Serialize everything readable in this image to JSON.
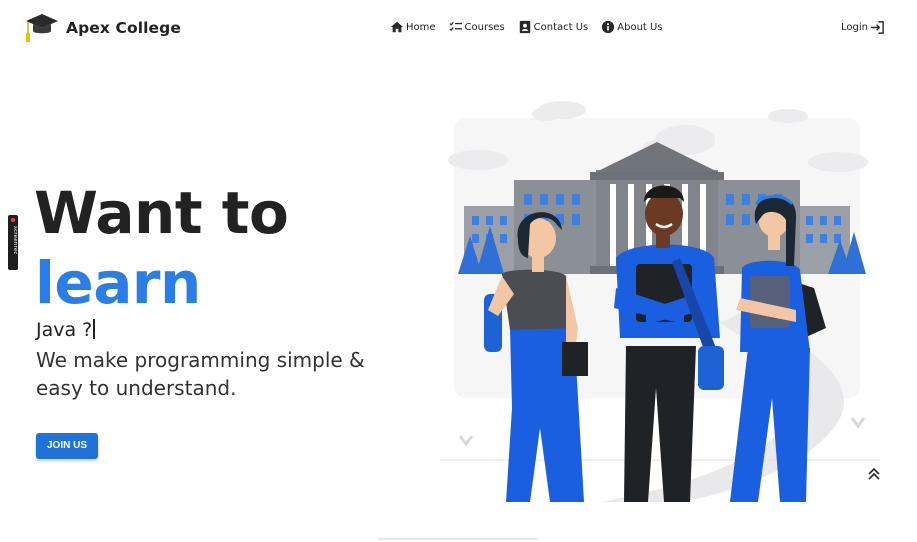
{
  "brand": {
    "name": "Apex College",
    "logo_icon": "graduation-cap-icon"
  },
  "nav": {
    "links": [
      {
        "label": "Home",
        "icon": "home-icon"
      },
      {
        "label": "Courses",
        "icon": "checklist-icon"
      },
      {
        "label": "Contact Us",
        "icon": "contact-card-icon"
      },
      {
        "label": "About Us",
        "icon": "info-icon"
      }
    ],
    "login": {
      "label": "Login",
      "icon": "sign-in-icon"
    }
  },
  "recorder_badge": {
    "label": "screenrec"
  },
  "hero": {
    "title_line1": "Want to",
    "title_line2": "learn",
    "typed_text": "Java ?",
    "tagline": "We make programming simple & easy to understand.",
    "cta_label": "JOIN US"
  },
  "colors": {
    "accent": "#2b7ee6",
    "button": "#1e72d8",
    "text": "#222222",
    "building": "#8a9095"
  },
  "illustration": {
    "subject": "students-in-front-of-college"
  },
  "scroll_top": {
    "icon": "double-chevron-up-icon"
  }
}
